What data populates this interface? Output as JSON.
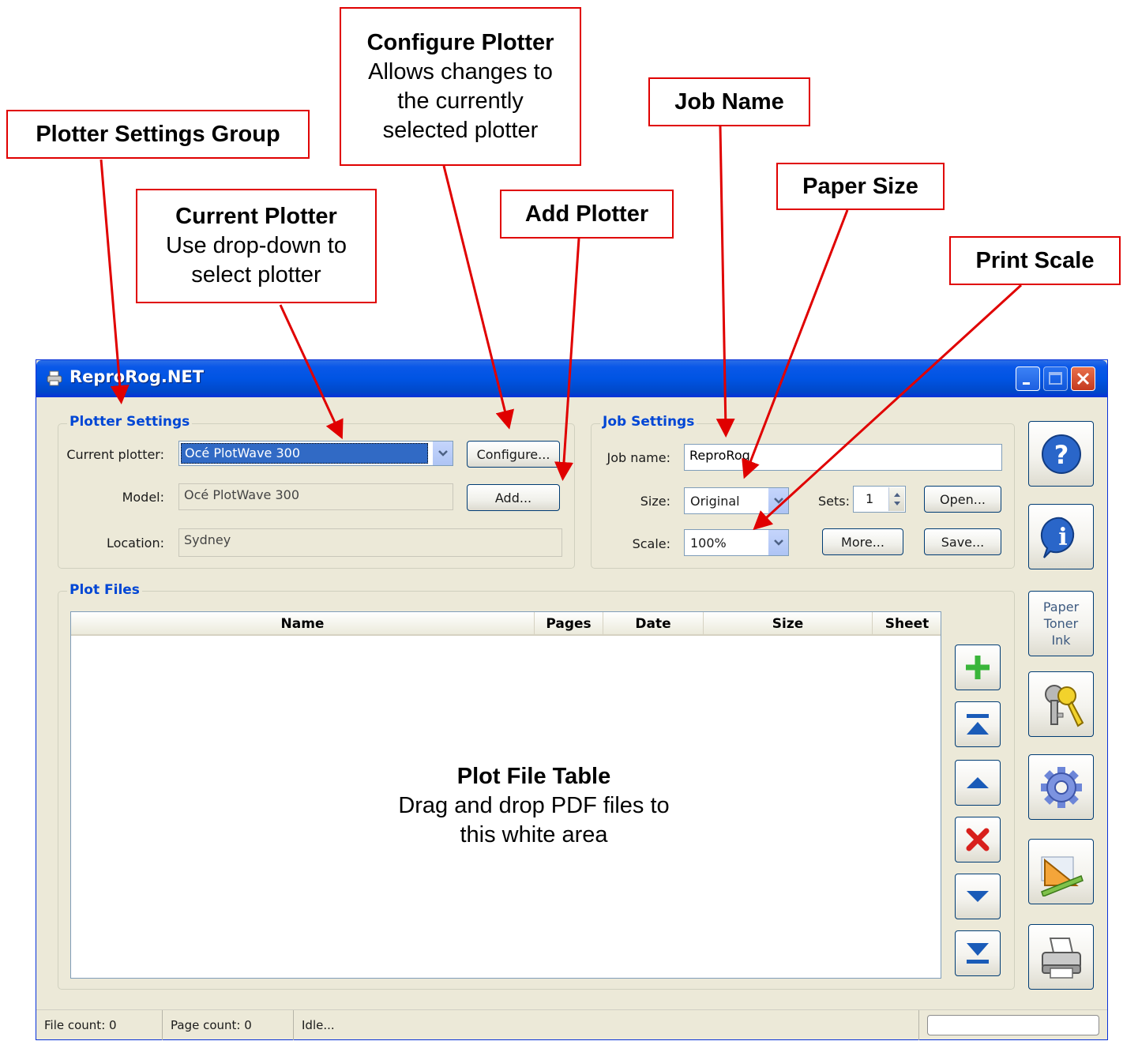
{
  "window": {
    "title": "ReproRog.NET"
  },
  "plotter_settings": {
    "title": "Plotter Settings",
    "current_label": "Current plotter:",
    "current_value": "Océ PlotWave 300",
    "model_label": "Model:",
    "model_value": "Océ PlotWave 300",
    "location_label": "Location:",
    "location_value": "Sydney",
    "configure_button": "Configure...",
    "add_button": "Add..."
  },
  "job_settings": {
    "title": "Job Settings",
    "job_name_label": "Job name:",
    "job_name_value": "ReproRog",
    "size_label": "Size:",
    "size_value": "Original",
    "sets_label": "Sets:",
    "sets_value": "1",
    "scale_label": "Scale:",
    "scale_value": "100%",
    "open_button": "Open...",
    "more_button": "More...",
    "save_button": "Save..."
  },
  "plot_files": {
    "title": "Plot Files",
    "columns": [
      "Name",
      "Pages",
      "Date",
      "Size",
      "Sheet"
    ],
    "overlay_title": "Plot File Table",
    "overlay_line1": "Drag and drop PDF files to",
    "overlay_line2": "this white area"
  },
  "side_buttons": {
    "paper_toner_ink": [
      "Paper",
      "Toner",
      "Ink"
    ]
  },
  "status_bar": {
    "file_count": "File count: 0",
    "page_count": "Page count: 0",
    "state": "Idle..."
  },
  "callouts": {
    "plotter_settings_group": {
      "title": "Plotter Settings Group"
    },
    "current_plotter": {
      "title": "Current Plotter",
      "line1": "Use drop-down to",
      "line2": "select plotter"
    },
    "configure_plotter": {
      "title": "Configure Plotter",
      "line1": "Allows changes to",
      "line2": "the currently",
      "line3": "selected plotter"
    },
    "add_plotter": {
      "title": "Add Plotter"
    },
    "job_name": {
      "title": "Job Name"
    },
    "paper_size": {
      "title": "Paper Size"
    },
    "print_scale": {
      "title": "Print Scale"
    }
  },
  "colors": {
    "callout_red": "#e00000",
    "xp_blue": "#0054e3",
    "group_title_blue": "#0046d5",
    "window_bg": "#ece9d8"
  }
}
